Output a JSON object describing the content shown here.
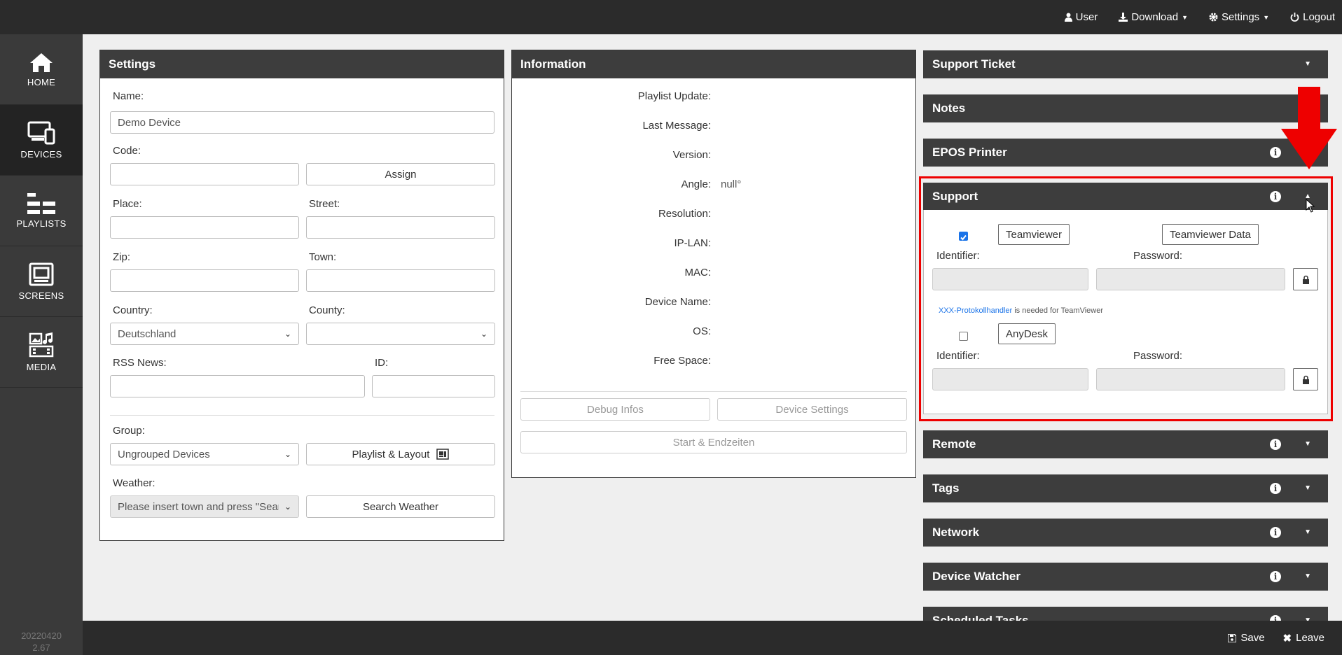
{
  "topbar": {
    "items": [
      {
        "label": "User",
        "icon": "user-icon"
      },
      {
        "label": "Download",
        "icon": "download-icon"
      },
      {
        "label": "Settings",
        "icon": "gear-icon"
      },
      {
        "label": "Logout",
        "icon": "power-icon"
      }
    ]
  },
  "sidebar": {
    "items": [
      {
        "label": "HOME",
        "icon": "home-icon"
      },
      {
        "label": "DEVICES",
        "icon": "devices-icon",
        "active": true
      },
      {
        "label": "PLAYLISTS",
        "icon": "playlists-icon"
      },
      {
        "label": "SCREENS",
        "icon": "screens-icon"
      },
      {
        "label": "MEDIA",
        "icon": "media-icon"
      }
    ],
    "version_line1": "20220420",
    "version_line2": "2.67"
  },
  "settings": {
    "title": "Settings",
    "name_label": "Name:",
    "name_value": "Demo Device",
    "code_label": "Code:",
    "code_value": "",
    "assign_label": "Assign",
    "place_label": "Place:",
    "street_label": "Street:",
    "zip_label": "Zip:",
    "town_label": "Town:",
    "country_label": "Country:",
    "country_value": "Deutschland",
    "county_label": "County:",
    "county_value": "",
    "rss_label": "RSS News:",
    "id_label": "ID:",
    "group_label": "Group:",
    "group_value": "Ungrouped Devices",
    "playlist_layout_label": "Playlist & Layout",
    "weather_label": "Weather:",
    "weather_value": "Please insert town and press \"Sear",
    "search_weather_label": "Search Weather"
  },
  "information": {
    "title": "Information",
    "rows": [
      {
        "label": "Playlist Update:",
        "value": ""
      },
      {
        "label": "Last Message:",
        "value": ""
      },
      {
        "label": "Version:",
        "value": ""
      },
      {
        "label": "Angle:",
        "value": "null°"
      },
      {
        "label": "Resolution:",
        "value": ""
      },
      {
        "label": "IP-LAN:",
        "value": ""
      },
      {
        "label": "MAC:",
        "value": ""
      },
      {
        "label": "Device Name:",
        "value": ""
      },
      {
        "label": "OS:",
        "value": ""
      },
      {
        "label": "Free Space:",
        "value": ""
      }
    ],
    "debug_label": "Debug Infos",
    "device_settings_label": "Device Settings",
    "start_end_label": "Start & Endzeiten"
  },
  "accordion": {
    "support_ticket": "Support Ticket",
    "notes": "Notes",
    "epos": "EPOS Printer",
    "support": "Support",
    "remote": "Remote",
    "tags": "Tags",
    "network": "Network",
    "device_watcher": "Device Watcher",
    "scheduled_tasks": "Scheduled Tasks"
  },
  "support": {
    "teamviewer_checked": true,
    "teamviewer_label": "Teamviewer",
    "teamviewer_data_label": "Teamviewer Data",
    "identifier_label": "Identifier:",
    "password_label": "Password:",
    "note_link": "XXX-Protokollhandler",
    "note_text": " is needed for TeamViewer",
    "anydesk_checked": false,
    "anydesk_label": "AnyDesk"
  },
  "footer": {
    "save_label": "Save",
    "leave_label": "Leave"
  },
  "colors": {
    "topbar": "#2b2b2b",
    "sidebar": "#3a3a3a",
    "panel_header": "#3d3d3d",
    "highlight": "#e00000",
    "link": "#1a73e8"
  }
}
